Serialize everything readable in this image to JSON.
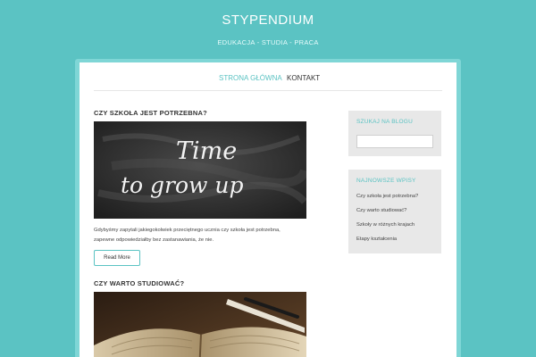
{
  "site": {
    "title": "STYPENDIUM",
    "description": "EDUKACJA - STUDIA - PRACA"
  },
  "nav": {
    "items": [
      {
        "label": "STRONA GŁÓWNA",
        "active": true
      },
      {
        "label": "KONTAKT",
        "active": false
      }
    ]
  },
  "posts": [
    {
      "title": "CZY SZKOŁA JEST POTRZEBNA?",
      "image_text": [
        "Time",
        "to grow up"
      ],
      "excerpt_line1": "Gdybyśmy zapytali jakiegokolwiek przeciętnego ucznia czy szkoła jest potrzebna,",
      "excerpt_line2": "zapewne odpowiedziałby bez zastanawiania,  że nie.",
      "read_more": "Read More"
    },
    {
      "title": "CZY WARTO STUDIOWAĆ?"
    }
  ],
  "sidebar": {
    "search": {
      "title": "SZUKAJ NA BLOGU",
      "value": "",
      "placeholder": ""
    },
    "recent": {
      "title": "NAJNOWSZE WPISY",
      "items": [
        {
          "label": "Czy szkoła jest potrzebna?"
        },
        {
          "label": "Czy warto studiować?"
        },
        {
          "label": "Szkoły w różnych krajach"
        },
        {
          "label": "Etapy kształcenia"
        }
      ]
    }
  },
  "colors": {
    "accent": "#5bc3c3",
    "background": "#5bc3c3",
    "panel": "#ffffff",
    "widget_bg": "#e8e8e8",
    "text": "#333333"
  }
}
